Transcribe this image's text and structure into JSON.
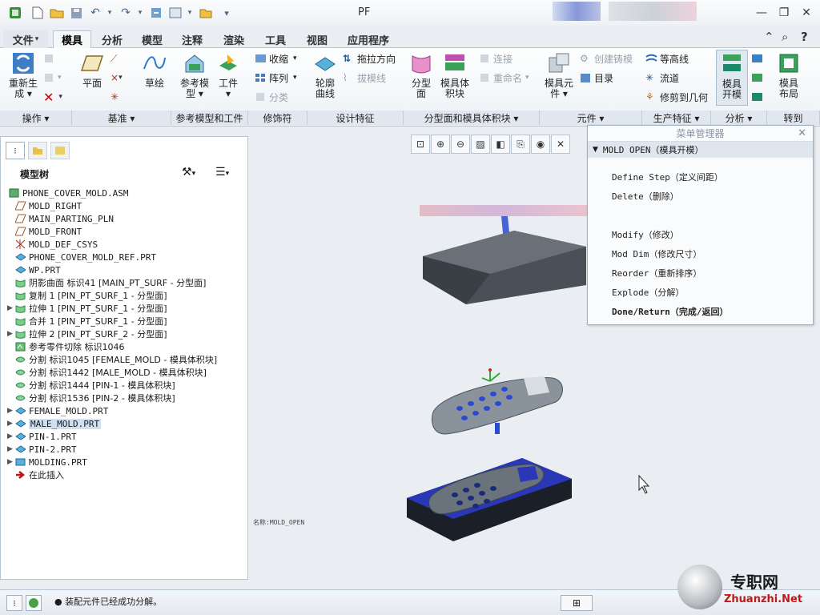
{
  "app": {
    "title": "PF"
  },
  "tabs": [
    {
      "label": "文件",
      "has_menu": true
    },
    {
      "label": "模具",
      "active": true
    },
    {
      "label": "分析"
    },
    {
      "label": "模型"
    },
    {
      "label": "注释"
    },
    {
      "label": "渲染"
    },
    {
      "label": "工具"
    },
    {
      "label": "视图"
    },
    {
      "label": "应用程序"
    }
  ],
  "ribbon": {
    "regen": "重新生成",
    "regen_l1": "重新生",
    "regen_l2": "成 ▾",
    "plane": "平面",
    "sketch": "草绘",
    "ref_model_l1": "参考模",
    "ref_model_l2": "型 ▾",
    "workpiece_l1": "工件",
    "workpiece_l2": "▾",
    "shrink": "收缩",
    "array": "阵列",
    "classify": "分类",
    "outline_l1": "轮廓",
    "outline_l2": "曲线",
    "pull_dir": "拖拉方向",
    "draft_check": "拔模线",
    "parting_l1": "分型",
    "parting_l2": "面",
    "mold_vol_l1": "模具体",
    "mold_vol_l2": "积块",
    "connect": "连接",
    "rename": "重命名",
    "mold_comp_l1": "模具元",
    "mold_comp_l2": "件 ▾",
    "create_casting": "创建铸模",
    "catalog": "目录",
    "contour": "等高线",
    "flow": "流道",
    "trim_geom": "修剪到几何",
    "mold_open_l1": "模具",
    "mold_open_l2": "开模",
    "mold_layout_l1": "模具",
    "mold_layout_l2": "布局",
    "groups": {
      "ops": "操作 ▾",
      "datum": "基准 ▾",
      "refmodel": "参考模型和工件",
      "modifier": "修饰符",
      "design": "设计特征",
      "parting": "分型面和模具体积块 ▾",
      "comp": "元件 ▾",
      "prod": "生产特征 ▾",
      "analysis": "分析 ▾",
      "goto": "转到"
    }
  },
  "model_tree": {
    "title": "模型树",
    "items": [
      {
        "label": "PHONE_COVER_MOLD.ASM",
        "icon": "assembly-icon",
        "expand": false
      },
      {
        "label": "MOLD_RIGHT",
        "icon": "datum-plane-icon",
        "expand": false
      },
      {
        "label": "MAIN_PARTING_PLN",
        "icon": "datum-plane-icon",
        "expand": false
      },
      {
        "label": "MOLD_FRONT",
        "icon": "datum-plane-icon",
        "expand": false
      },
      {
        "label": "MOLD_DEF_CSYS",
        "icon": "csys-icon",
        "expand": false
      },
      {
        "label": "PHONE_COVER_MOLD_REF.PRT",
        "icon": "part-icon",
        "expand": false
      },
      {
        "label": "WP.PRT",
        "icon": "part-icon",
        "expand": false
      },
      {
        "label": "阴影曲面 标识41 [MAIN_PT_SURF - 分型面]",
        "icon": "surface-icon",
        "expand": false
      },
      {
        "label": "复制 1 [PIN_PT_SURF_1 - 分型面]",
        "icon": "surface-icon",
        "expand": false
      },
      {
        "label": "拉伸 1 [PIN_PT_SURF_1 - 分型面]",
        "icon": "surface-icon",
        "expand": true
      },
      {
        "label": "合并 1 [PIN_PT_SURF_1 - 分型面]",
        "icon": "surface-icon",
        "expand": false
      },
      {
        "label": "拉伸 2 [PIN_PT_SURF_2 - 分型面]",
        "icon": "surface-icon",
        "expand": true
      },
      {
        "label": "参考零件切除 标识1046",
        "icon": "cut-icon",
        "expand": false
      },
      {
        "label": "分割 标识1045 [FEMALE_MOLD - 模具体积块]",
        "icon": "split-icon",
        "expand": false
      },
      {
        "label": "分割 标识1442 [MALE_MOLD - 模具体积块]",
        "icon": "split-icon",
        "expand": false
      },
      {
        "label": "分割 标识1444 [PIN-1 - 模具体积块]",
        "icon": "split-icon",
        "expand": false
      },
      {
        "label": "分割 标识1536 [PIN-2 - 模具体积块]",
        "icon": "split-icon",
        "expand": false
      },
      {
        "label": "FEMALE_MOLD.PRT",
        "icon": "part-icon",
        "expand": true
      },
      {
        "label": "MALE_MOLD.PRT",
        "icon": "part-icon",
        "expand": true,
        "selected": true
      },
      {
        "label": "PIN-1.PRT",
        "icon": "part-icon",
        "expand": true
      },
      {
        "label": "PIN-2.PRT",
        "icon": "part-icon",
        "expand": true
      },
      {
        "label": "MOLDING.PRT",
        "icon": "molding-icon",
        "expand": true
      },
      {
        "label": "在此插入",
        "icon": "insert-arrow-icon",
        "expand": false
      }
    ]
  },
  "menu_manager": {
    "title": "菜单管理器",
    "header": "MOLD OPEN（模具开模）",
    "items": [
      {
        "label": "Define Step（定义间距）",
        "bold": false
      },
      {
        "label": "Delete（删除）",
        "bold": false
      },
      {
        "label": "Modify（修改）",
        "bold": false
      },
      {
        "label": "Mod Dim（修改尺寸）",
        "bold": false
      },
      {
        "label": "Reorder（重新排序）",
        "bold": false
      },
      {
        "label": "Explode（分解）",
        "bold": false
      },
      {
        "label": "Done/Return（完成/返回）",
        "bold": true
      }
    ]
  },
  "viewport": {
    "label": "名称:MOLD_OPEN"
  },
  "status": {
    "message": "● 装配元件已经成功分解。"
  },
  "watermark": {
    "cn": "专职网",
    "url": "Zhuanzhi.Net"
  }
}
